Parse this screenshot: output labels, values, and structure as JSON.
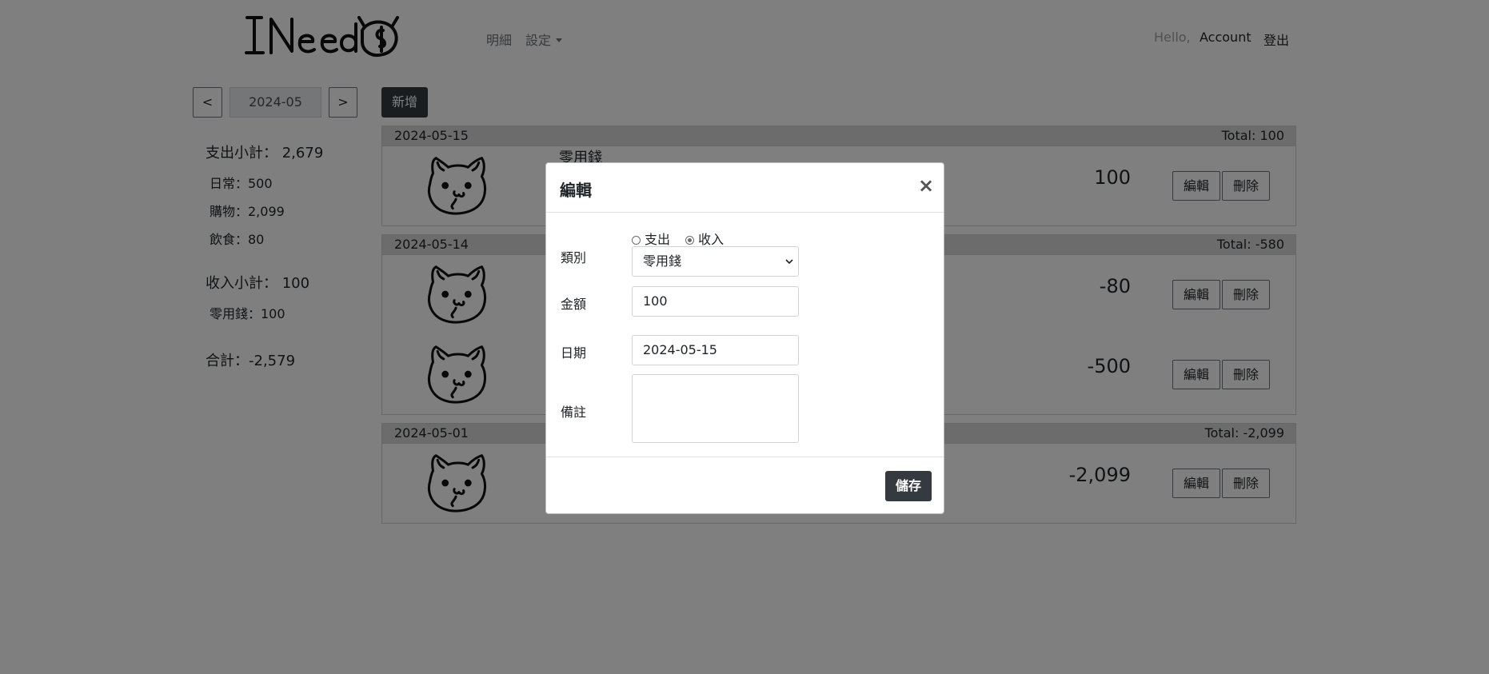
{
  "nav": {
    "logo_text": "INeed$",
    "detail": "明細",
    "settings": "設定",
    "hello": "Hello,",
    "account": "Account",
    "logout": "登出"
  },
  "month": {
    "prev": "<",
    "value": "2024-05",
    "next": ">"
  },
  "add_label": "新增",
  "summary": {
    "expense_label": "支出小計：",
    "expense_total": "2,679",
    "expense_items": [
      "日常：500",
      "購物：2,099",
      "飲食：80"
    ],
    "income_label": "收入小計：",
    "income_total": "100",
    "income_items": [
      "零用錢：100"
    ],
    "grand_total": "合計：-2,579"
  },
  "groups": [
    {
      "date": "2024-05-15",
      "total": "Total: 100",
      "records": [
        {
          "name": "零用錢",
          "amount": "100"
        }
      ]
    },
    {
      "date": "2024-05-14",
      "total": "Total: -580",
      "records": [
        {
          "name": "",
          "amount": "-80"
        },
        {
          "name": "",
          "amount": "-500"
        }
      ]
    },
    {
      "date": "2024-05-01",
      "total": "Total: -2,099",
      "records": [
        {
          "name": "",
          "amount": "-2,099"
        }
      ]
    }
  ],
  "row_buttons": {
    "edit": "編輯",
    "delete": "刪除"
  },
  "modal": {
    "title": "編輯",
    "close": "×",
    "category_label": "類別",
    "type_expense": "支出",
    "type_income": "收入",
    "selected_type": "收入",
    "category_value": "零用錢",
    "amount_label": "金額",
    "amount_value": "100",
    "date_label": "日期",
    "date_value": "2024-05-15",
    "note_label": "備註",
    "note_value": "",
    "save": "儲存"
  },
  "icons": {
    "record": "cat-face-icon",
    "dropdown": "chevron-down-icon"
  }
}
